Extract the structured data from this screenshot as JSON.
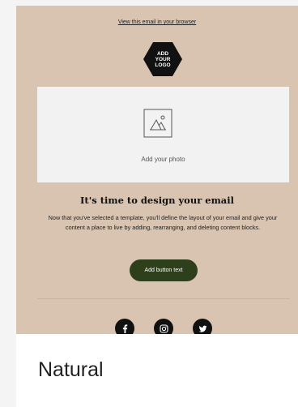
{
  "preview": {
    "view_link": "View this email in your browser",
    "logo_text": "ADD\nYOUR\nLOGO",
    "photo_label": "Add your photo",
    "headline": "It's time to design your email",
    "body": "Now that you've selected a template, you'll define the layout of your email and give your content a place to live by adding, rearranging, and deleting content blocks.",
    "cta": "Add button text",
    "social_icons": [
      "facebook-icon",
      "instagram-icon",
      "twitter-icon"
    ],
    "background_color": "#d8c4b0",
    "button_color": "#2e3f1b"
  },
  "template": {
    "name": "Natural"
  }
}
